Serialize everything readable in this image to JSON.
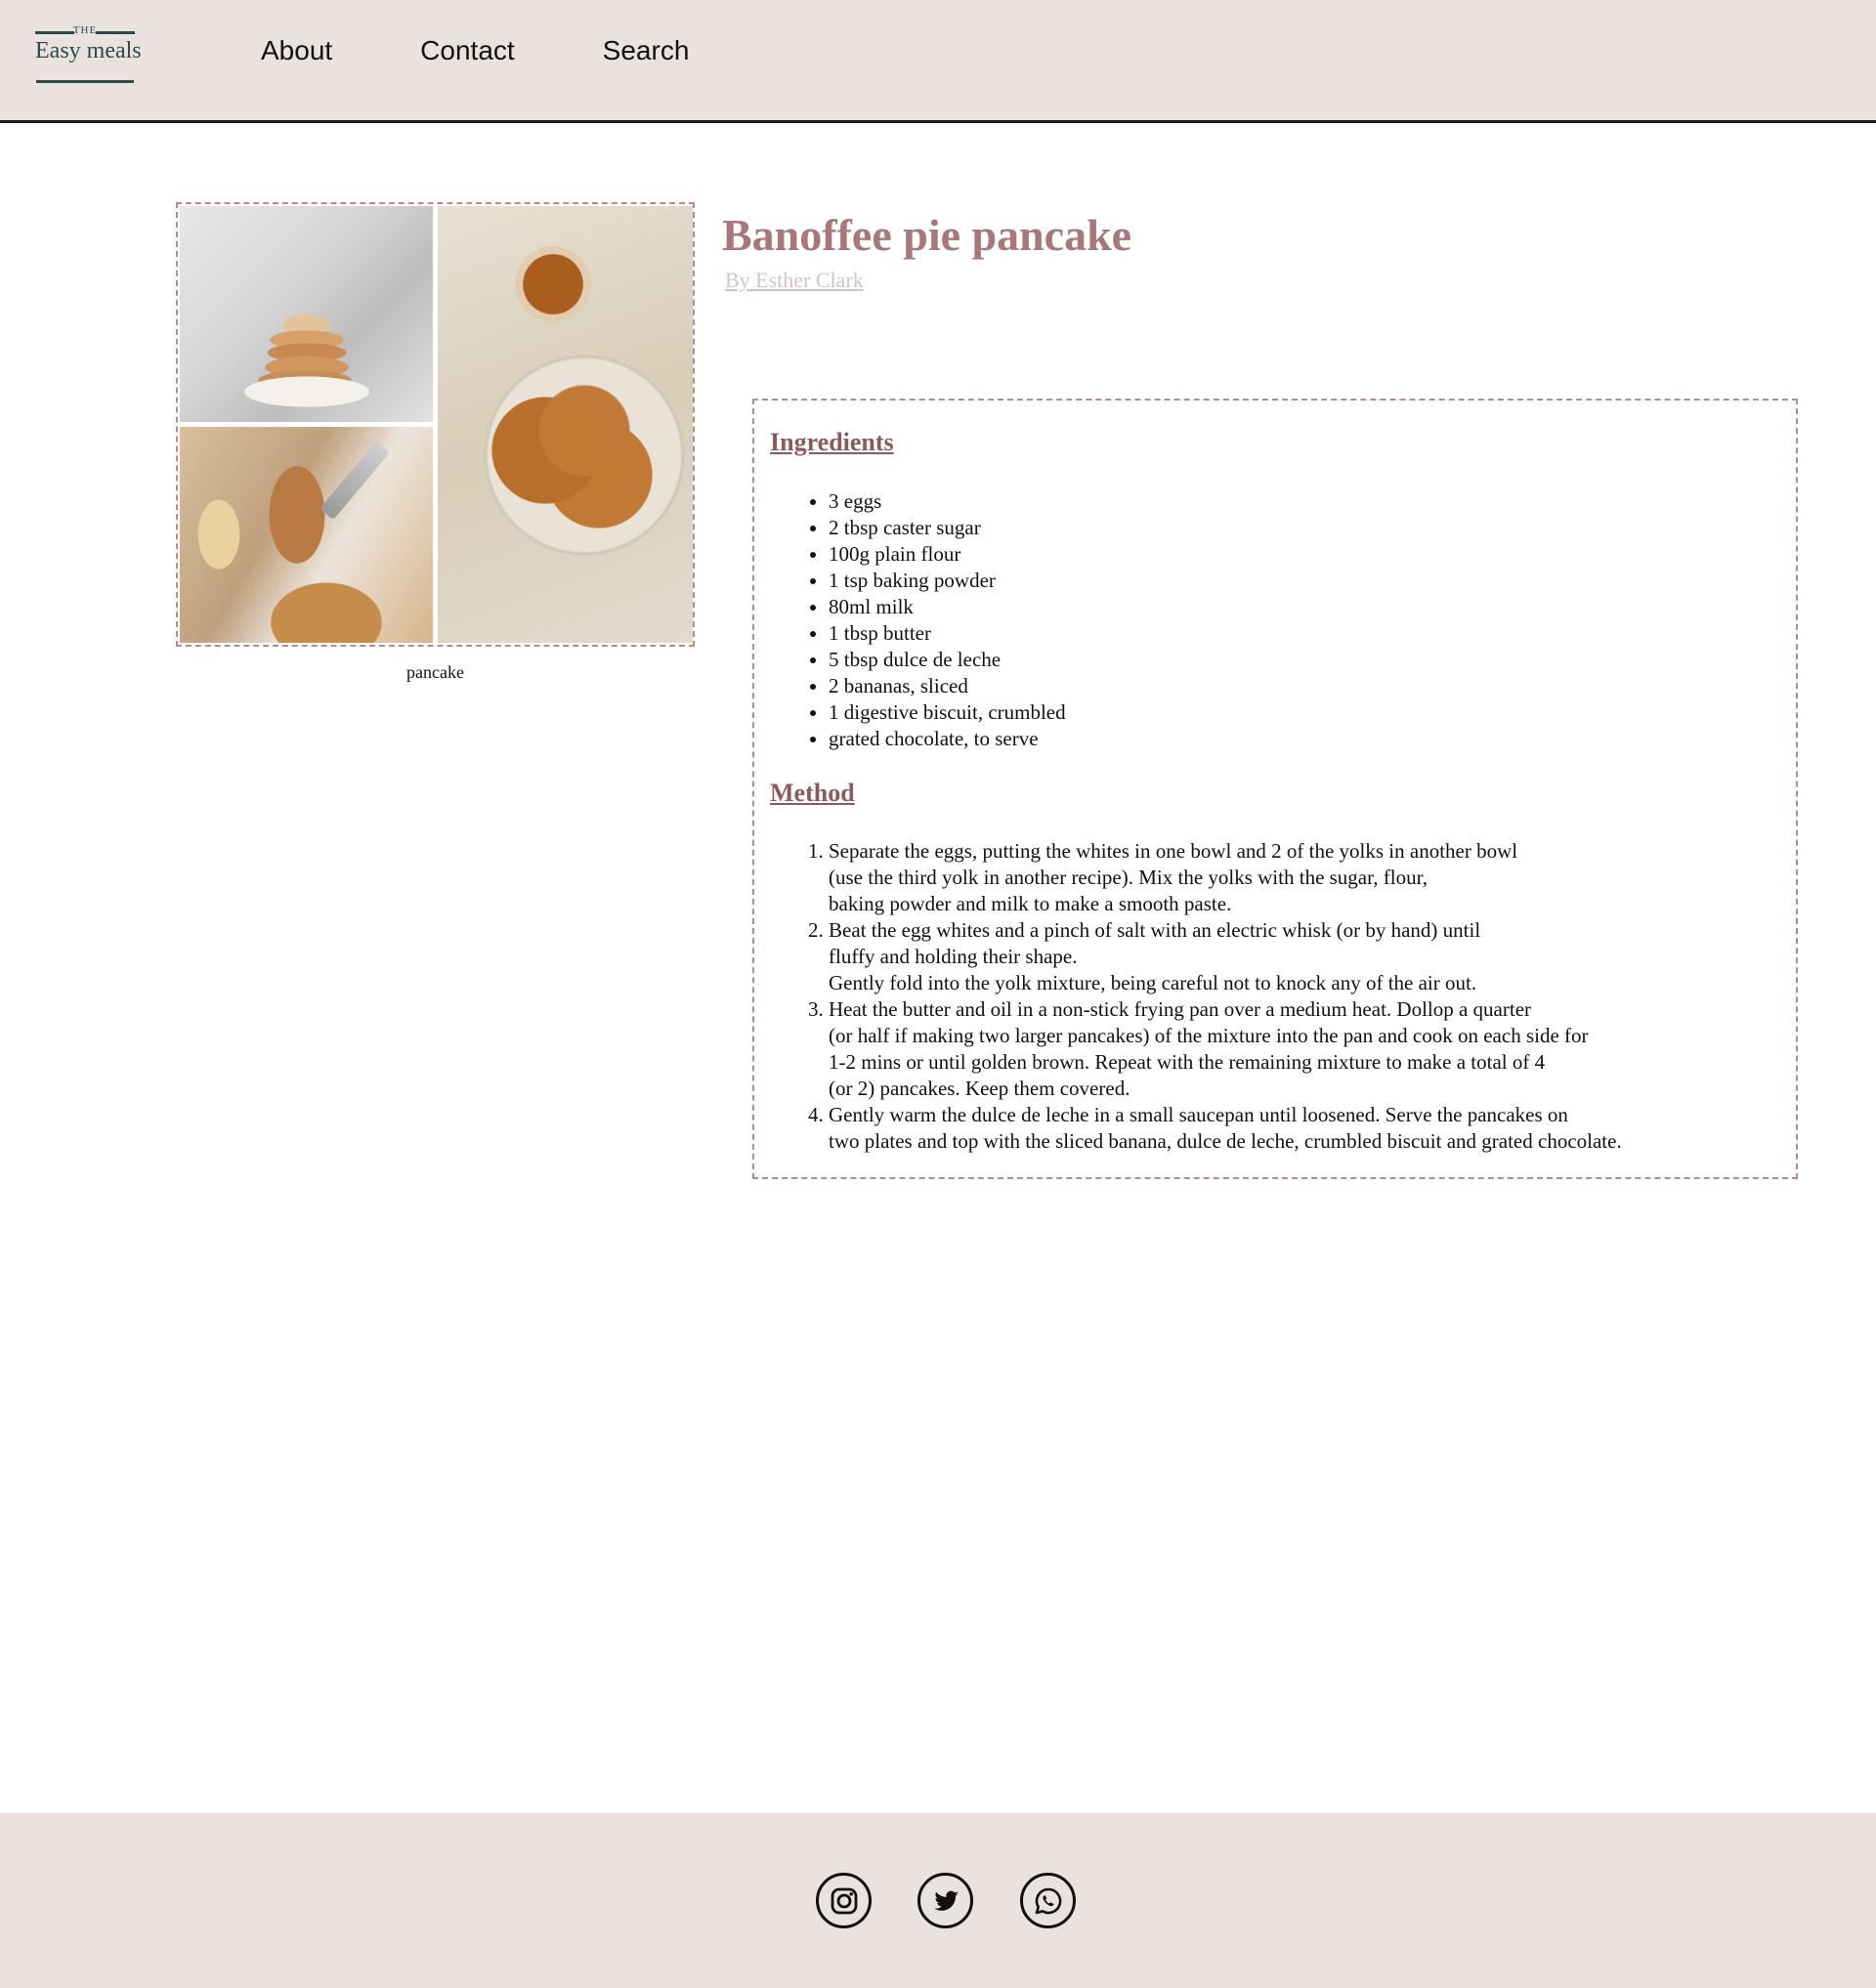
{
  "brand": {
    "the": "THE",
    "name": "Easy meals"
  },
  "nav": [
    {
      "label": "About"
    },
    {
      "label": "Contact"
    },
    {
      "label": "Search"
    }
  ],
  "recipe": {
    "title": "Banoffee pie pancake",
    "author": "By Esther Clark",
    "image_caption": "pancake",
    "ingredients_heading": "Ingredients",
    "ingredients": [
      "3 eggs",
      "2 tbsp caster sugar",
      "100g plain flour",
      "1 tsp baking powder",
      "80ml milk",
      "1 tbsp butter",
      "5 tbsp dulce de leche",
      "2 bananas, sliced",
      "1 digestive biscuit, crumbled",
      "grated chocolate, to serve"
    ],
    "method_heading": "Method",
    "method": [
      [
        "Separate the eggs, putting the whites in one bowl and 2 of the yolks in another bowl",
        "(use the third yolk in another recipe). Mix the yolks with the sugar, flour,",
        "baking powder and milk to make a smooth paste."
      ],
      [
        "Beat the egg whites and a pinch of salt with an electric whisk (or by hand) until",
        "fluffy and holding their shape.",
        "Gently fold into the yolk mixture, being careful not to knock any of the air out."
      ],
      [
        "Heat the butter and oil in a non-stick frying pan over a medium heat. Dollop a quarter",
        "(or half if making two larger pancakes) of the mixture into the pan and cook on each side for",
        "1-2 mins or until golden brown. Repeat with the remaining mixture to make a total of 4",
        "(or 2) pancakes. Keep them covered."
      ],
      [
        "Gently warm the dulce de leche in a small saucepan until loosened. Serve the pancakes on",
        "two plates and top with the sliced banana, dulce de leche, crumbled biscuit and grated chocolate."
      ]
    ]
  },
  "footer": {
    "icons": [
      "instagram-icon",
      "twitter-icon",
      "whatsapp-icon"
    ]
  },
  "colors": {
    "header_bg": "#e9e2de",
    "title": "#a9767c",
    "heading": "#8a5a5e",
    "dashed_border": "#b98892",
    "author": "#cfc6c3"
  }
}
